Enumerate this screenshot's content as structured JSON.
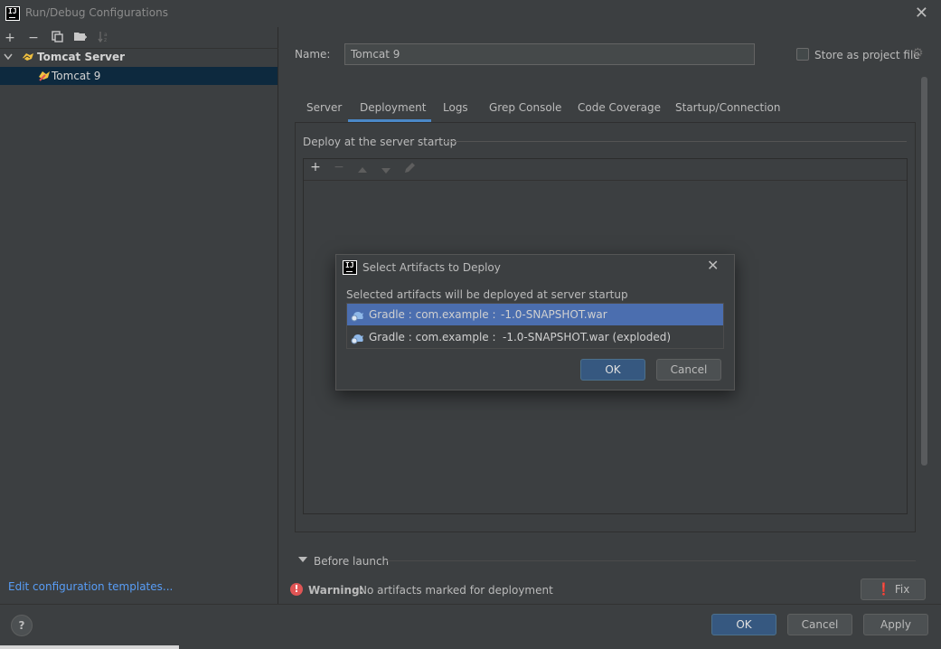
{
  "window": {
    "title": "Run/Debug Configurations",
    "logo": "IJ",
    "close_icon": "✕"
  },
  "sidebar": {
    "toolbar": [
      "add-icon",
      "remove-icon",
      "copy-icon",
      "folder-icon",
      "sort-icon"
    ],
    "tree": {
      "root_label": "Tomcat Server",
      "child_label": "Tomcat 9"
    },
    "edit_templates_link": "Edit configuration templates..."
  },
  "config": {
    "name_label": "Name:",
    "name_value": "Tomcat 9",
    "store_label": "Store as project file",
    "store_checked": false
  },
  "tabs": [
    {
      "label": "Server"
    },
    {
      "label": "Deployment",
      "active": true
    },
    {
      "label": "Logs"
    },
    {
      "label": "Grep Console"
    },
    {
      "label": "Code Coverage"
    },
    {
      "label": "Startup/Connection"
    }
  ],
  "deployment": {
    "header": "Deploy at the server startup",
    "toolbar": [
      "add-icon",
      "remove-icon",
      "move-up-icon",
      "move-down-icon",
      "edit-icon"
    ]
  },
  "before_launch": {
    "label": "Before launch"
  },
  "warning": {
    "strong": "Warning:",
    "text": "No artifacts marked for deployment",
    "fix_label": "Fix"
  },
  "footer": {
    "help_label": "?",
    "ok_label": "OK",
    "cancel_label": "Cancel",
    "apply_label": "Apply"
  },
  "dialog": {
    "title": "Select Artifacts to Deploy",
    "description": "Selected artifacts will be deployed at server startup",
    "artifacts": [
      {
        "prefix": "Gradle : com.example :",
        "suffix": "-1.0-SNAPSHOT.war",
        "selected": true
      },
      {
        "prefix": "Gradle : com.example :",
        "suffix": "-1.0-SNAPSHOT.war (exploded)",
        "selected": false
      }
    ],
    "ok_label": "OK",
    "cancel_label": "Cancel"
  },
  "colors": {
    "background": "#3c3f41",
    "selection": "#4b6eaf",
    "tree_selection": "#0d293e",
    "accent_tab": "#4a88c7",
    "primary_button": "#365880",
    "link": "#589df6",
    "error": "#e05555"
  }
}
